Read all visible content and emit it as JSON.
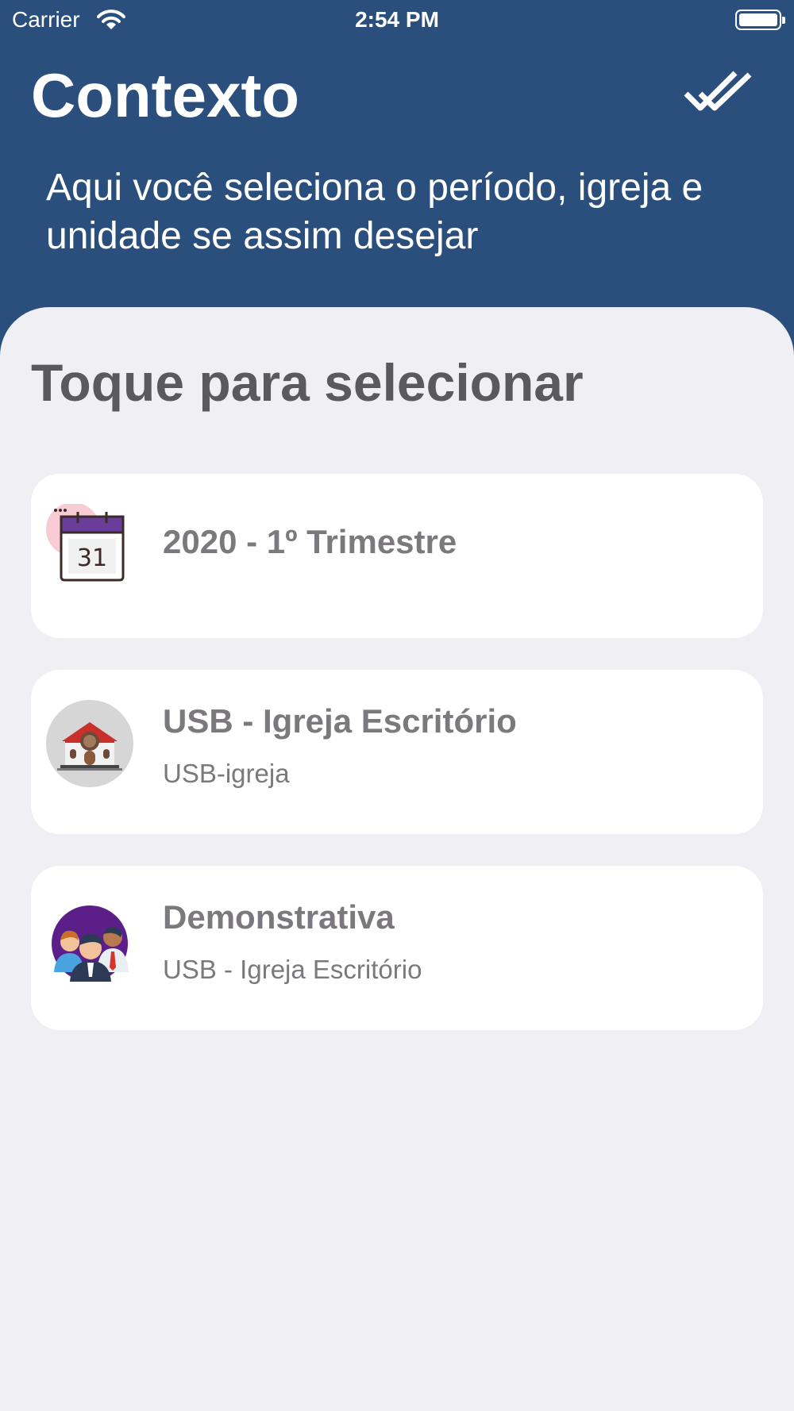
{
  "status_bar": {
    "carrier": "Carrier",
    "time": "2:54 PM",
    "wifi_icon": "wifi-icon",
    "battery_icon": "battery-icon"
  },
  "header": {
    "title": "Contexto",
    "subtitle": "Aqui você seleciona o período, igreja e unidade se assim desejar",
    "done_icon": "double-check-icon",
    "background_color": "#2b4f7d"
  },
  "content": {
    "section_title": "Toque para selecionar",
    "background_color": "#efeff4",
    "items": [
      {
        "title": "2020 - 1º Trimestre",
        "subtitle": "",
        "icon": "calendar-icon"
      },
      {
        "title": "USB - Igreja Escritório",
        "subtitle": "USB-igreja",
        "icon": "church-icon"
      },
      {
        "title": "Demonstrativa",
        "subtitle": "USB - Igreja Escritório",
        "icon": "people-group-icon"
      }
    ]
  }
}
